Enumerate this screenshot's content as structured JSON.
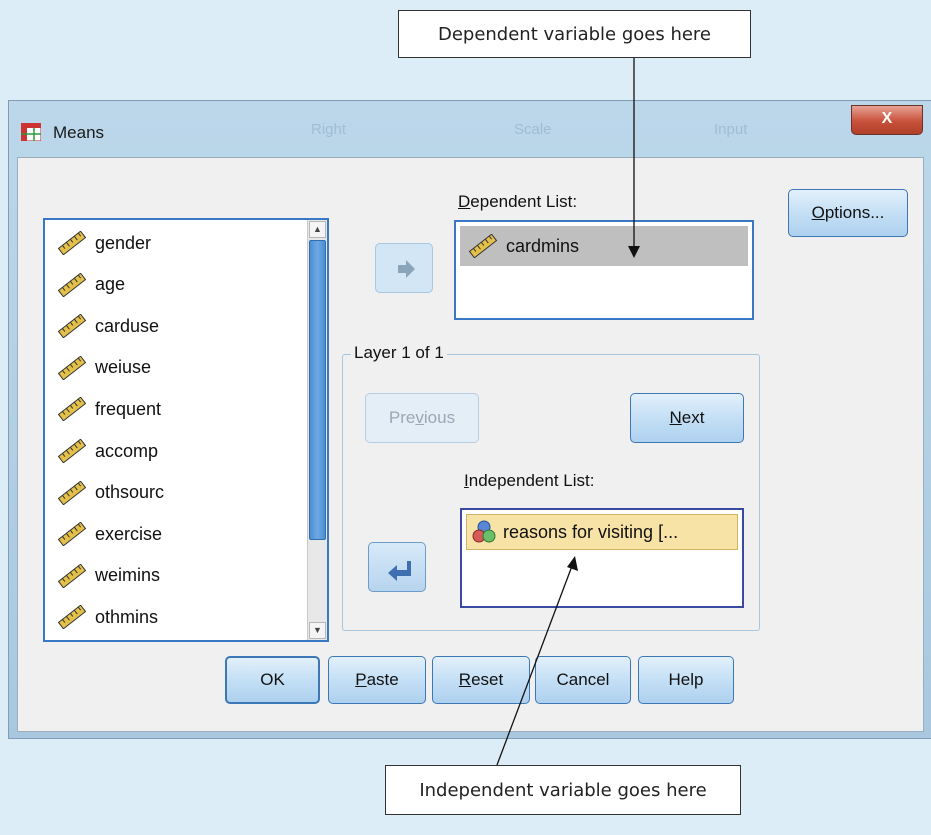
{
  "callouts": {
    "dependent": "Dependent variable goes here",
    "independent": "Independent variable goes here"
  },
  "window": {
    "title": "Means",
    "close_label": "X",
    "background_ghost_labels": [
      "Right",
      "Scale",
      "Input"
    ]
  },
  "variables": {
    "items": [
      "gender",
      "age",
      "carduse",
      "weiuse",
      "frequent",
      "accomp",
      "othsourc",
      "exercise",
      "weimins",
      "othmins"
    ],
    "item_icon": "scale-ruler-icon"
  },
  "dependent": {
    "label": "Dependent List:",
    "items": [
      "cardmins"
    ]
  },
  "layer": {
    "label": "Layer 1 of 1",
    "previous_label": "Previous",
    "next_label": "Next"
  },
  "independent": {
    "label": "Independent List:",
    "items": [
      "reasons for visiting [..."
    ],
    "item_icon": "nominal-circles-icon"
  },
  "buttons": {
    "options": "Options...",
    "ok": "OK",
    "paste": "Paste",
    "reset": "Reset",
    "cancel": "Cancel",
    "help": "Help"
  },
  "colors": {
    "background": "#dcedf8",
    "accent": "#3a78c6",
    "selection": "#f7e3a6"
  }
}
